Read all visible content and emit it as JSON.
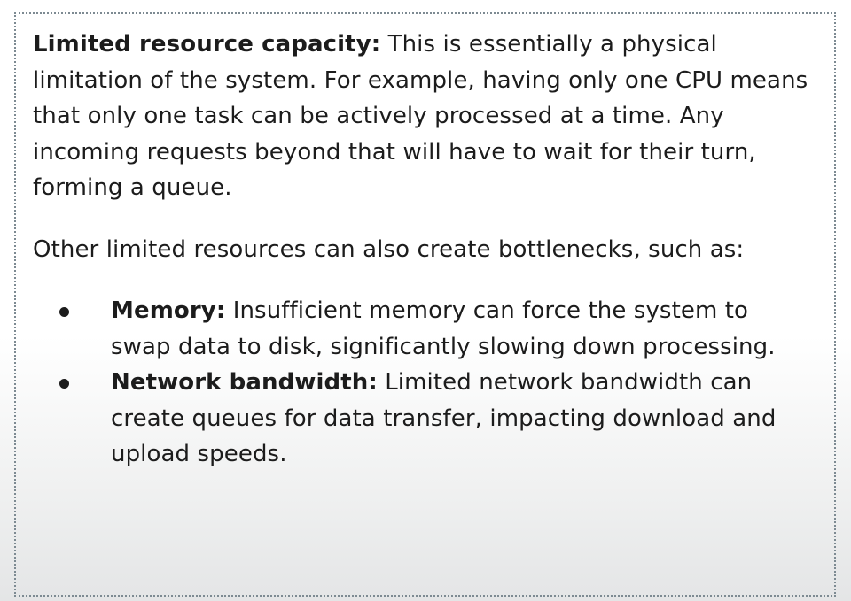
{
  "paragraph1": {
    "term": "Limited resource capacity:",
    "text": " This is essentially a physical limitation of the system. For example, having only one CPU means that only one task can be actively processed at a time. Any incoming requests beyond that will have to wait for their turn, forming a queue."
  },
  "paragraph2": {
    "text": "Other limited resources can also create bottlenecks, such as:"
  },
  "bullets": [
    {
      "term": "Memory:",
      "text": " Insufficient memory can force the system to swap data to disk, significantly slowing down processing."
    },
    {
      "term": "Network bandwidth:",
      "text": " Limited network bandwidth can create queues for data transfer, impacting download and upload speeds."
    }
  ]
}
